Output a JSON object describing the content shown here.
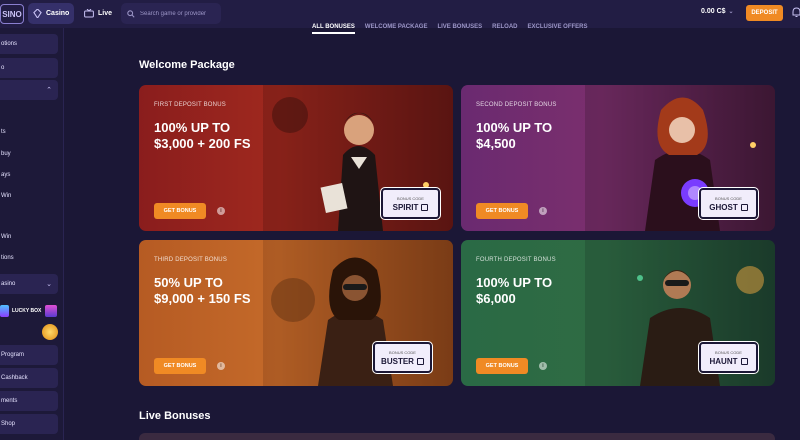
{
  "header": {
    "logo_text": "SINO",
    "nav_casino": "Casino",
    "nav_live": "Live",
    "search_placeholder": "Search game or provider",
    "balance": "0.00 C$",
    "deposit": "DEPOSIT"
  },
  "sidebar": {
    "items": [
      {
        "label": "otions"
      },
      {
        "label": "o"
      },
      {
        "label": ""
      },
      {
        "label": "ts"
      },
      {
        "label": "buy"
      },
      {
        "label": "ays"
      },
      {
        "label": "Win"
      },
      {
        "label": "Win"
      },
      {
        "label": "tions"
      },
      {
        "label": "asino"
      },
      {
        "label": "LUCKY BOX"
      },
      {
        "label": "Program"
      },
      {
        "label": "Cashback"
      },
      {
        "label": "ments"
      },
      {
        "label": "Shop"
      }
    ]
  },
  "tabs": [
    "ALL BONUSES",
    "WELCOME PACKAGE",
    "LIVE BONUSES",
    "RELOAD",
    "EXCLUSIVE OFFERS"
  ],
  "welcome": {
    "title": "Welcome Package",
    "cards": [
      {
        "label": "FIRST DEPOSIT BONUS",
        "line1": "100% UP TO",
        "line2": "$3,000 + 200 FS",
        "button": "GET BONUS",
        "code_label": "BONUS CODE",
        "code": "SPIRIT",
        "accent": "#a0291e"
      },
      {
        "label": "SECOND DEPOSIT BONUS",
        "line1": "100% UP TO",
        "line2": "$4,500",
        "button": "GET BONUS",
        "code_label": "BONUS CODE",
        "code": "GHOST",
        "accent": "#7b2f6d"
      },
      {
        "label": "THIRD DEPOSIT BONUS",
        "line1": "50% UP TO",
        "line2": "$9,000 + 150 FS",
        "button": "GET BONUS",
        "code_label": "BONUS CODE",
        "code": "BUSTER",
        "accent": "#c46a2a"
      },
      {
        "label": "FOURTH DEPOSIT BONUS",
        "line1": "100% UP TO",
        "line2": "$6,000",
        "button": "GET BONUS",
        "code_label": "BONUS CODE",
        "code": "HAUNT",
        "accent": "#2f6b43"
      }
    ]
  },
  "live": {
    "title": "Live Bonuses"
  },
  "colors": {
    "background": "#1b1736",
    "topbar": "#221d44",
    "accent_button": "#f08a24"
  }
}
